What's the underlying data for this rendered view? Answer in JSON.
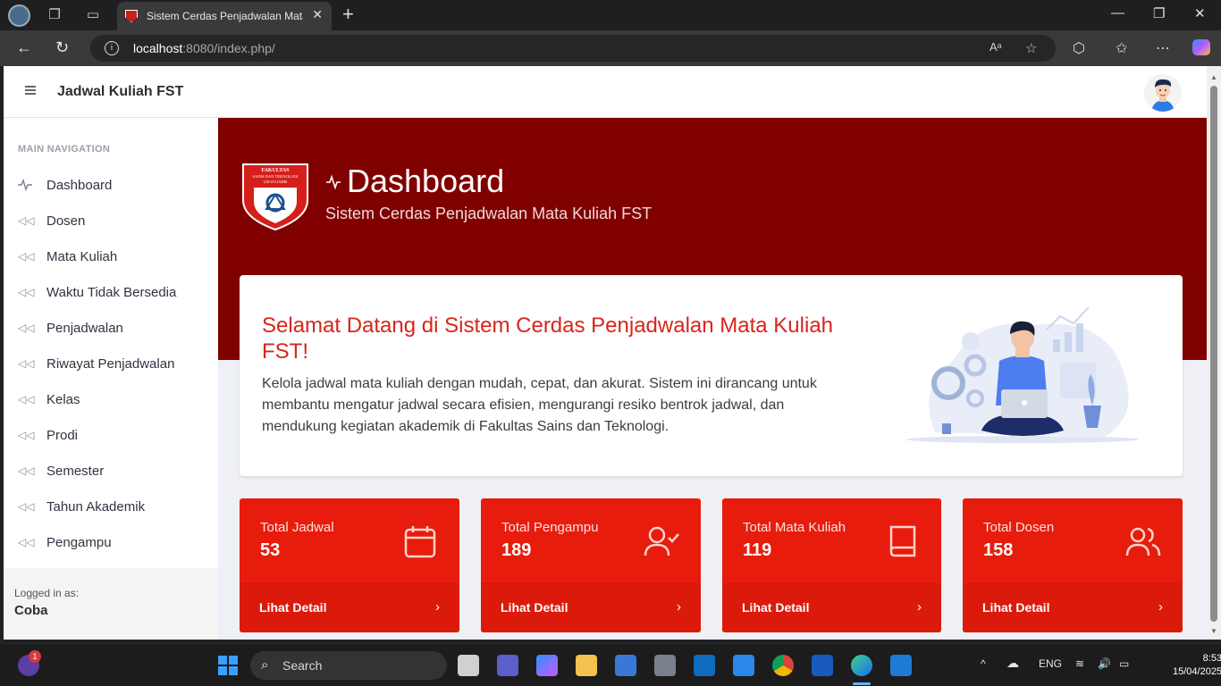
{
  "browser": {
    "tab_title": "Sistem Cerdas Penjadwalan Mata",
    "url_host": "localhost",
    "url_rest": ":8080/index.php/"
  },
  "app": {
    "brand": "Jadwal Kuliah FST"
  },
  "sidebar": {
    "heading": "MAIN NAVIGATION",
    "items": [
      {
        "label": "Dashboard",
        "icon": "activity-icon"
      },
      {
        "label": "Dosen",
        "icon": "double-chevron-left-icon"
      },
      {
        "label": "Mata Kuliah",
        "icon": "double-chevron-left-icon"
      },
      {
        "label": "Waktu Tidak Bersedia",
        "icon": "double-chevron-left-icon"
      },
      {
        "label": "Penjadwalan",
        "icon": "double-chevron-left-icon"
      },
      {
        "label": "Riwayat Penjadwalan",
        "icon": "double-chevron-left-icon"
      },
      {
        "label": "Kelas",
        "icon": "double-chevron-left-icon"
      },
      {
        "label": "Prodi",
        "icon": "double-chevron-left-icon"
      },
      {
        "label": "Semester",
        "icon": "double-chevron-left-icon"
      },
      {
        "label": "Tahun Akademik",
        "icon": "double-chevron-left-icon"
      },
      {
        "label": "Pengampu",
        "icon": "double-chevron-left-icon"
      }
    ],
    "logged_label": "Logged in as:",
    "user": "Coba"
  },
  "header": {
    "title": "Dashboard",
    "subtitle": "Sistem Cerdas Penjadwalan Mata Kuliah FST",
    "logo_text_1": "FAKULTAS",
    "logo_text_2": "SAINS DAN TEKNOLOGI",
    "logo_text_3": "UIN STS JAMBI"
  },
  "welcome": {
    "title": "Selamat Datang di Sistem Cerdas Penjadwalan Mata Kuliah FST!",
    "text": "Kelola jadwal mata kuliah dengan mudah, cepat, dan akurat. Sistem ini dirancang untuk membantu mengatur jadwal secara efisien, mengurangi resiko bentrok jadwal, dan mendukung kegiatan akademik di Fakultas Sains dan Teknologi."
  },
  "cards": [
    {
      "label": "Total Jadwal",
      "value": "53",
      "link": "Lihat Detail",
      "icon": "calendar-icon"
    },
    {
      "label": "Total Pengampu",
      "value": "189",
      "link": "Lihat Detail",
      "icon": "user-check-icon"
    },
    {
      "label": "Total Mata Kuliah",
      "value": "119",
      "link": "Lihat Detail",
      "icon": "book-icon"
    },
    {
      "label": "Total Dosen",
      "value": "158",
      "link": "Lihat Detail",
      "icon": "users-icon"
    }
  ],
  "taskbar": {
    "search_placeholder": "Search",
    "notification_count": "1",
    "language": "ENG",
    "time": "8:53",
    "date": "15/04/2025"
  },
  "colors": {
    "hero": "#800000",
    "accent": "#e81c0c",
    "welcome_title": "#d7261a"
  }
}
